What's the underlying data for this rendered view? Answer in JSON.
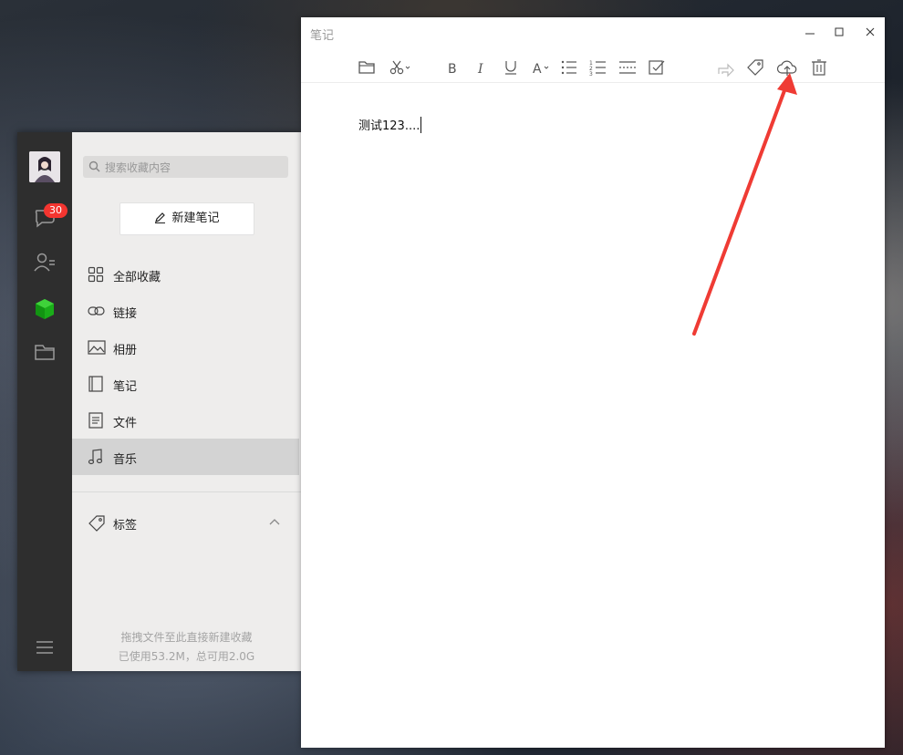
{
  "wallpaper": {
    "caption": ""
  },
  "favorites": {
    "badge_count": "30",
    "search_placeholder": "搜索收藏内容",
    "new_note_label": "新建笔记",
    "categories": [
      {
        "label": "全部收藏",
        "icon": "grid-icon"
      },
      {
        "label": "链接",
        "icon": "link-icon"
      },
      {
        "label": "相册",
        "icon": "image-icon"
      },
      {
        "label": "笔记",
        "icon": "notebook-icon"
      },
      {
        "label": "文件",
        "icon": "document-icon"
      },
      {
        "label": "音乐",
        "icon": "music-icon",
        "selected": true
      }
    ],
    "tags_label": "标签",
    "footer_hint": "拖拽文件至此直接新建收藏",
    "footer_storage": "已使用53.2M，总可用2.0G"
  },
  "note": {
    "window_title": "笔记",
    "content_text": "测试123....",
    "toolbar": [
      "folder-icon",
      "scissors-icon",
      "bold-icon",
      "italic-icon",
      "underline-icon",
      "font-color-icon",
      "bullet-list-icon",
      "numbered-list-icon",
      "divider-icon",
      "checkbox-icon",
      "share-icon",
      "tag-icon",
      "cloud-upload-icon",
      "trash-icon"
    ]
  },
  "colors": {
    "accent_green": "#1aad19",
    "badge_red": "#f43530",
    "annotation_red": "#ef3b34"
  }
}
